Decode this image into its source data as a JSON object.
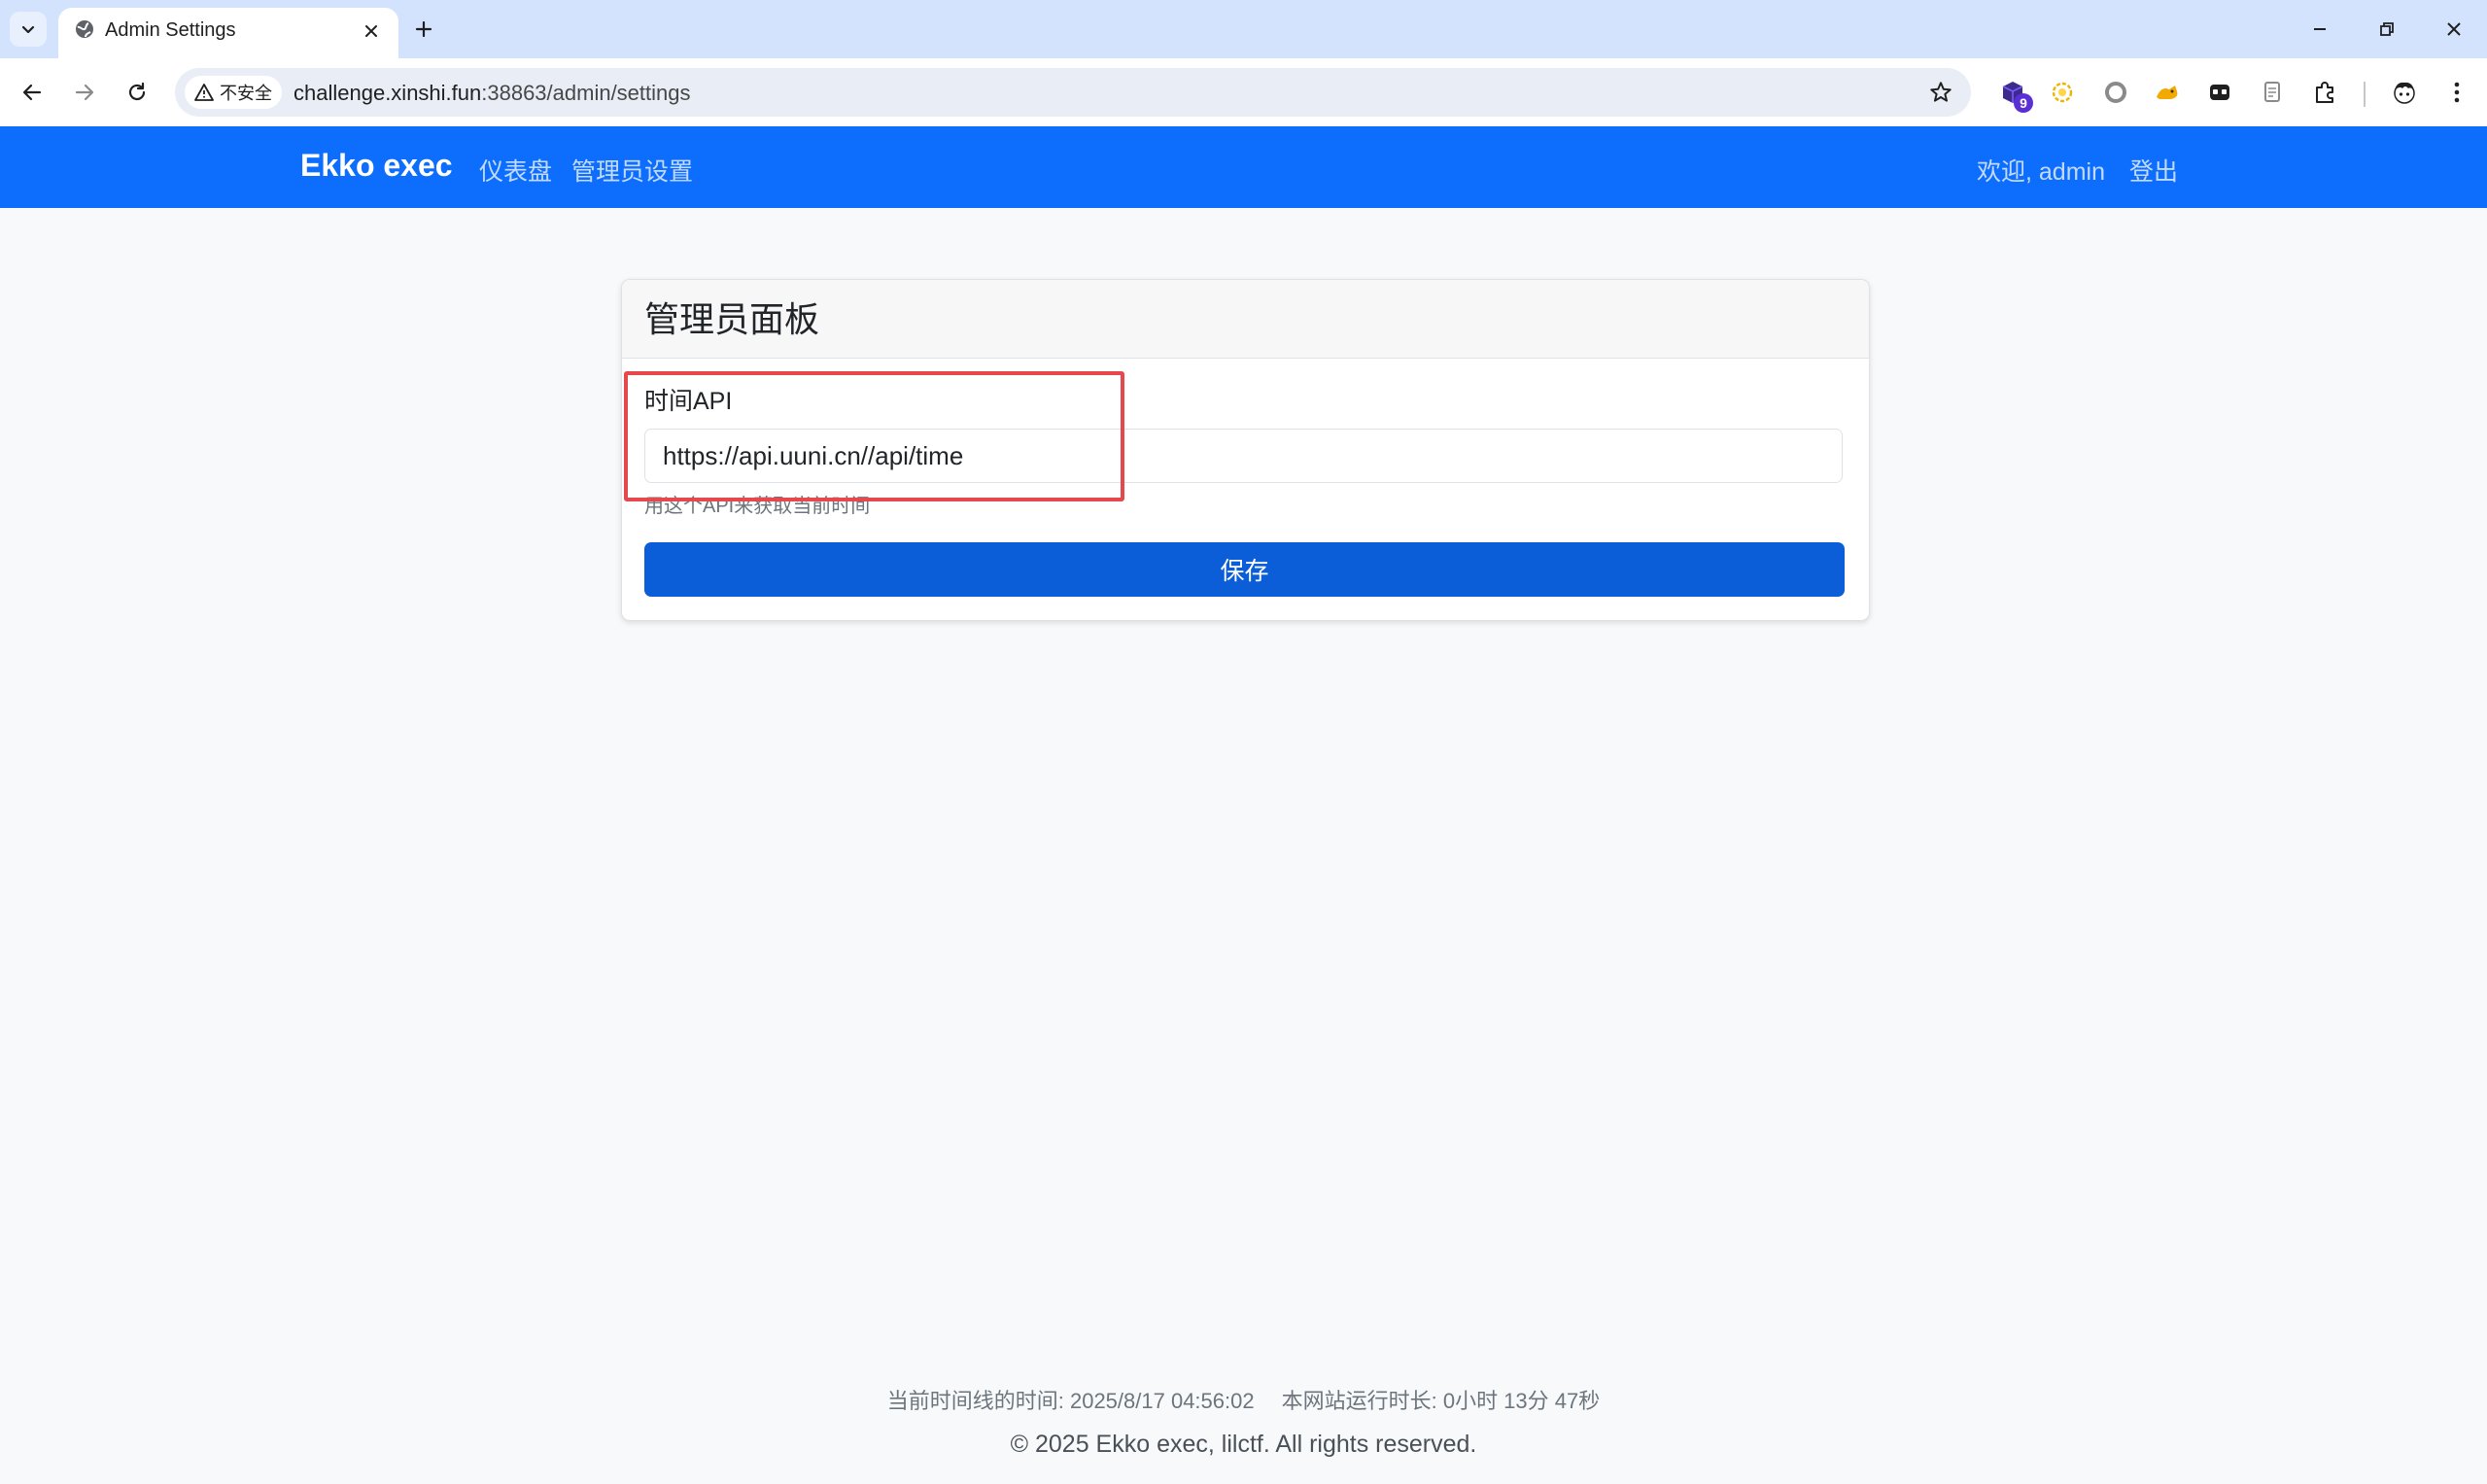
{
  "browser": {
    "tab_title": "Admin Settings",
    "security_label": "不安全",
    "url_host": "challenge.xinshi.fun",
    "url_path": ":38863/admin/settings",
    "extension_badge": "9"
  },
  "navbar": {
    "brand": "Ekko exec",
    "links": [
      "仪表盘",
      "管理员设置"
    ],
    "welcome": "欢迎, admin",
    "logout": "登出",
    "color": "#0d6efd"
  },
  "panel": {
    "title": "管理员面板",
    "field_label": "时间API",
    "field_value": "https://api.uuni.cn//api/time",
    "help_text": "用这个API来获取当前时间",
    "save_label": "保存",
    "highlight_color": "#e5484d"
  },
  "footer": {
    "current_time": "当前时间线的时间: 2025/8/17 04:56:02",
    "uptime": "本网站运行时长: 0小时 13分 47秒",
    "copyright": "© 2025 Ekko exec, lilctf. All rights reserved."
  }
}
